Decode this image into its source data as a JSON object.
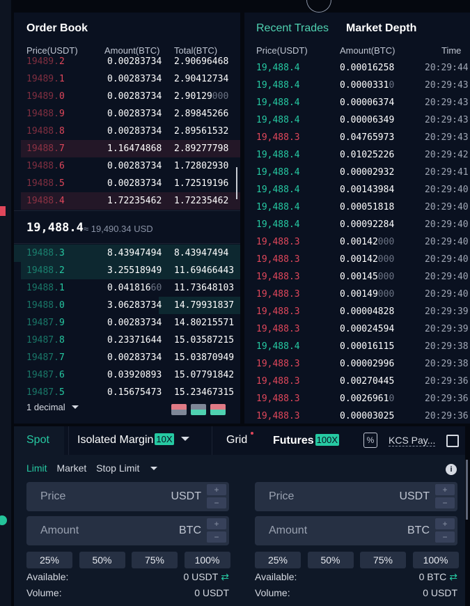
{
  "order_book": {
    "title": "Order Book",
    "headers": {
      "price": "Price(USDT)",
      "amount": "Amount(BTC)",
      "total": "Total(BTC)"
    },
    "asks": [
      {
        "p1": "19489.",
        "p2": "2",
        "amount": "0.00283734",
        "total": "2.90696468",
        "depth": 0
      },
      {
        "p1": "19489.",
        "p2": "1",
        "amount": "0.00283734",
        "total": "2.90412734",
        "depth": 0
      },
      {
        "p1": "19489.",
        "p2": "0",
        "amount": "0.00283734",
        "total": "2.90129",
        "totalz": "000",
        "depth": 0
      },
      {
        "p1": "19488.",
        "p2": "9",
        "amount": "0.00283734",
        "total": "2.89845266",
        "depth": 0
      },
      {
        "p1": "19488.",
        "p2": "8",
        "amount": "0.00283734",
        "total": "2.89561532",
        "depth": 0
      },
      {
        "p1": "19488.",
        "p2": "7",
        "amount": "1.16474868",
        "total": "2.89277798",
        "depth": 0.97
      },
      {
        "p1": "19488.",
        "p2": "6",
        "amount": "0.00283734",
        "total": "1.72802930",
        "depth": 0
      },
      {
        "p1": "19488.",
        "p2": "5",
        "amount": "0.00283734",
        "total": "1.72519196",
        "depth": 0
      },
      {
        "p1": "19488.",
        "p2": "4",
        "amount": "1.72235462",
        "total": "1.72235462",
        "depth": 0.97
      }
    ],
    "mid_price": "19,488.4",
    "mid_usd": "≈ 19,490.34 USD",
    "bids": [
      {
        "p1": "19488.",
        "p2": "3",
        "amount": "8.43947494",
        "total": "8.43947494",
        "depth": 1.0
      },
      {
        "p1": "19488.",
        "p2": "2",
        "amount": "3.25518949",
        "total": "11.69466443",
        "depth": 0.97
      },
      {
        "p1": "19488.",
        "p2": "1",
        "amount": "0.041816",
        "amountz": "60",
        "total": "11.73648103",
        "depth": 0
      },
      {
        "p1": "19488.",
        "p2": "0",
        "amount": "3.06283734",
        "total": "14.79931837",
        "depth": 0.36
      },
      {
        "p1": "19487.",
        "p2": "9",
        "amount": "0.00283734",
        "total": "14.80215571",
        "depth": 0
      },
      {
        "p1": "19487.",
        "p2": "8",
        "amount": "0.23371644",
        "total": "15.03587215",
        "depth": 0
      },
      {
        "p1": "19487.",
        "p2": "7",
        "amount": "0.00283734",
        "total": "15.03870949",
        "depth": 0
      },
      {
        "p1": "19487.",
        "p2": "6",
        "amount": "0.03920893",
        "total": "15.07791842",
        "depth": 0
      },
      {
        "p1": "19487.",
        "p2": "5",
        "amount": "0.15675473",
        "total": "15.23467315",
        "depth": 0
      }
    ],
    "decimal_label": "1 decimal",
    "colors": {
      "ask": "#e0475b",
      "bid": "#26c9a2"
    }
  },
  "recent_trades": {
    "tab_active": "Recent Trades",
    "tab_other": "Market Depth",
    "headers": {
      "price": "Price(USDT)",
      "amount": "Amount(BTC)",
      "time": "Time"
    },
    "rows": [
      {
        "side": "buy",
        "price": "19,488.4",
        "amount": "0.00016258",
        "time": "20:29:44"
      },
      {
        "side": "buy",
        "price": "19,488.4",
        "amount": "0.0000331",
        "amountz": "0",
        "time": "20:29:43"
      },
      {
        "side": "buy",
        "price": "19,488.4",
        "amount": "0.00006374",
        "time": "20:29:43"
      },
      {
        "side": "buy",
        "price": "19,488.4",
        "amount": "0.00006349",
        "time": "20:29:43"
      },
      {
        "side": "sell",
        "price": "19,488.3",
        "amount": "0.04765973",
        "time": "20:29:43"
      },
      {
        "side": "buy",
        "price": "19,488.4",
        "amount": "0.01025226",
        "time": "20:29:42"
      },
      {
        "side": "buy",
        "price": "19,488.4",
        "amount": "0.00002932",
        "time": "20:29:41"
      },
      {
        "side": "buy",
        "price": "19,488.4",
        "amount": "0.00143984",
        "time": "20:29:40"
      },
      {
        "side": "buy",
        "price": "19,488.4",
        "amount": "0.00051818",
        "time": "20:29:40"
      },
      {
        "side": "buy",
        "price": "19,488.4",
        "amount": "0.00092284",
        "time": "20:29:40"
      },
      {
        "side": "sell",
        "price": "19,488.3",
        "amount": "0.00142",
        "amountz": "000",
        "time": "20:29:40"
      },
      {
        "side": "sell",
        "price": "19,488.3",
        "amount": "0.00142",
        "amountz": "000",
        "time": "20:29:40"
      },
      {
        "side": "sell",
        "price": "19,488.3",
        "amount": "0.00145",
        "amountz": "000",
        "time": "20:29:40"
      },
      {
        "side": "sell",
        "price": "19,488.3",
        "amount": "0.00149",
        "amountz": "000",
        "time": "20:29:40"
      },
      {
        "side": "sell",
        "price": "19,488.3",
        "amount": "0.00004828",
        "time": "20:29:39"
      },
      {
        "side": "sell",
        "price": "19,488.3",
        "amount": "0.00024594",
        "time": "20:29:39"
      },
      {
        "side": "buy",
        "price": "19,488.4",
        "amount": "0.00016115",
        "time": "20:29:38"
      },
      {
        "side": "sell",
        "price": "19,488.3",
        "amount": "0.00002996",
        "time": "20:29:38"
      },
      {
        "side": "sell",
        "price": "19,488.3",
        "amount": "0.00270445",
        "time": "20:29:36"
      },
      {
        "side": "sell",
        "price": "19,488.3",
        "amount": "0.0026961",
        "amountz": "0",
        "time": "20:29:36"
      },
      {
        "side": "sell",
        "price": "19,488.3",
        "amount": "0.00003025",
        "time": "20:29:36"
      }
    ]
  },
  "trade_panel": {
    "tabs": {
      "spot": "Spot",
      "isolated": "Isolated Margin",
      "isolated_badge": "10X",
      "grid": "Grid",
      "futures": "Futures",
      "futures_badge": "100X",
      "kcs": "KCS Pay..."
    },
    "order_types": {
      "limit": "Limit",
      "market": "Market",
      "stop_limit": "Stop Limit"
    },
    "buy": {
      "price_placeholder": "Price",
      "price_unit": "USDT",
      "amount_placeholder": "Amount",
      "amount_unit": "BTC",
      "pcts": [
        "25%",
        "50%",
        "75%",
        "100%"
      ],
      "available_label": "Available:",
      "available_value": "0 USDT",
      "volume_label": "Volume:",
      "volume_value": "0 USDT"
    },
    "sell": {
      "price_placeholder": "Price",
      "price_unit": "USDT",
      "amount_placeholder": "Amount",
      "amount_unit": "BTC",
      "pcts": [
        "25%",
        "50%",
        "75%",
        "100%"
      ],
      "available_label": "Available:",
      "available_value": "0 BTC",
      "volume_label": "Volume:",
      "volume_value": "0 USDT"
    }
  },
  "icons": {
    "plus": "+",
    "minus": "−",
    "transfer": "⇄",
    "info": "i",
    "kcs_icon": "%"
  }
}
